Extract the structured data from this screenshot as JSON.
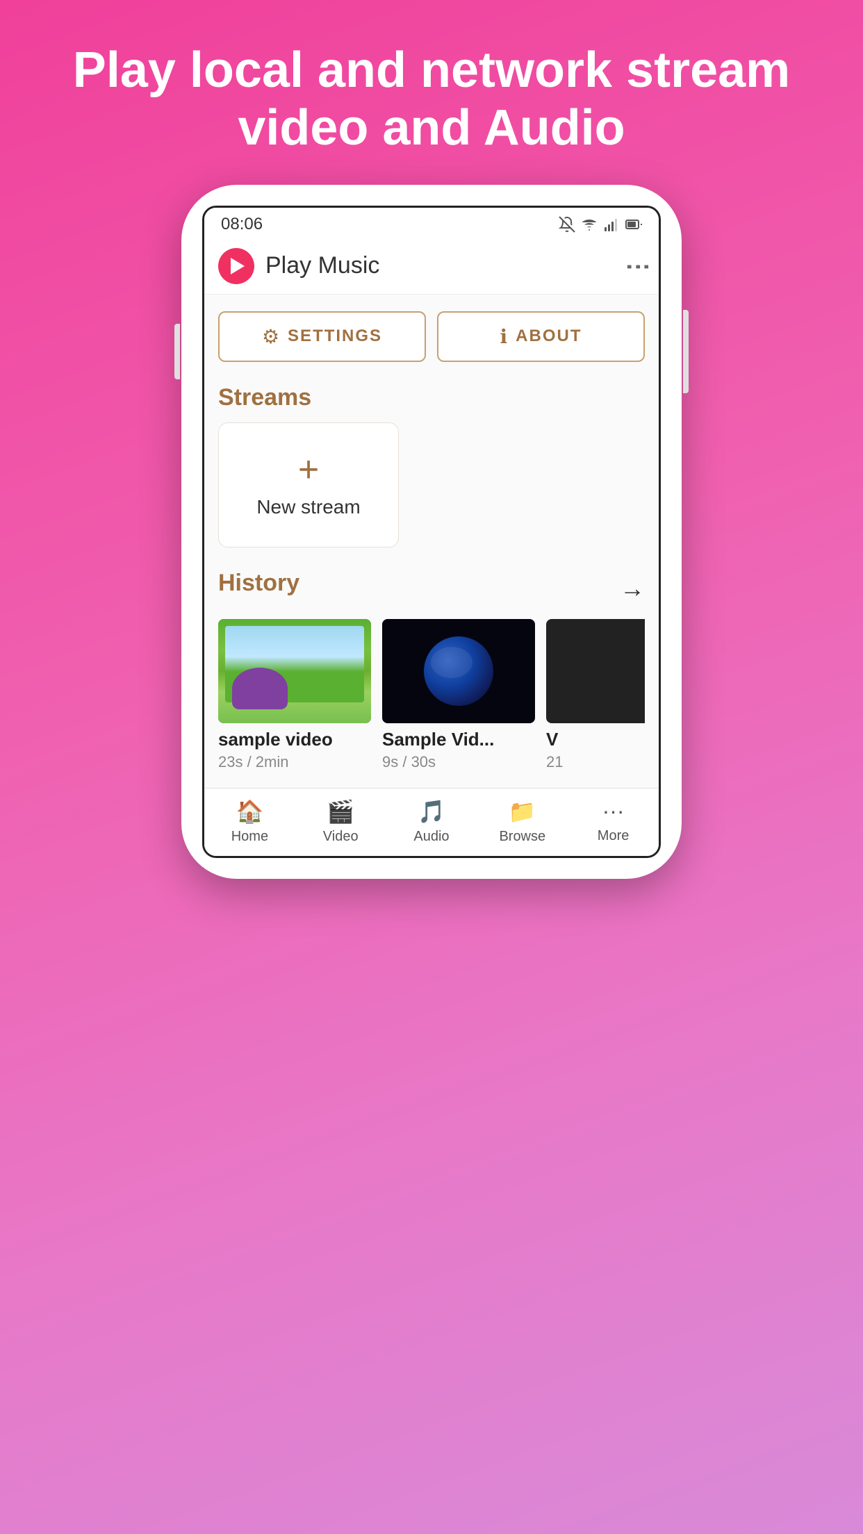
{
  "hero": {
    "title": "Play local and network stream video and Audio"
  },
  "statusBar": {
    "time": "08:06"
  },
  "appBar": {
    "title": "Play Music",
    "menuDotsLabel": "⋮"
  },
  "buttons": {
    "settings": "SETTINGS",
    "about": "ABOUT"
  },
  "streams": {
    "sectionTitle": "Streams",
    "newStreamLabel": "New stream",
    "plusIcon": "+"
  },
  "history": {
    "sectionTitle": "History",
    "arrowIcon": "→",
    "items": [
      {
        "title": "sample video",
        "subtitle": "23s / 2min",
        "thumbType": "nature"
      },
      {
        "title": "Sample Vid...",
        "subtitle": "9s / 30s",
        "thumbType": "earth"
      },
      {
        "title": "V",
        "subtitle": "21",
        "thumbType": "partial"
      }
    ]
  },
  "bottomNav": {
    "items": [
      {
        "label": "Home",
        "icon": "🏠"
      },
      {
        "label": "Video",
        "icon": "🎬"
      },
      {
        "label": "Audio",
        "icon": "🎵"
      },
      {
        "label": "Browse",
        "icon": "📁"
      },
      {
        "label": "More",
        "icon": "···"
      }
    ]
  },
  "colors": {
    "accent": "#f03060",
    "background_gradient_start": "#f0409a",
    "background_gradient_end": "#d88ad8",
    "brown": "#a07040"
  }
}
